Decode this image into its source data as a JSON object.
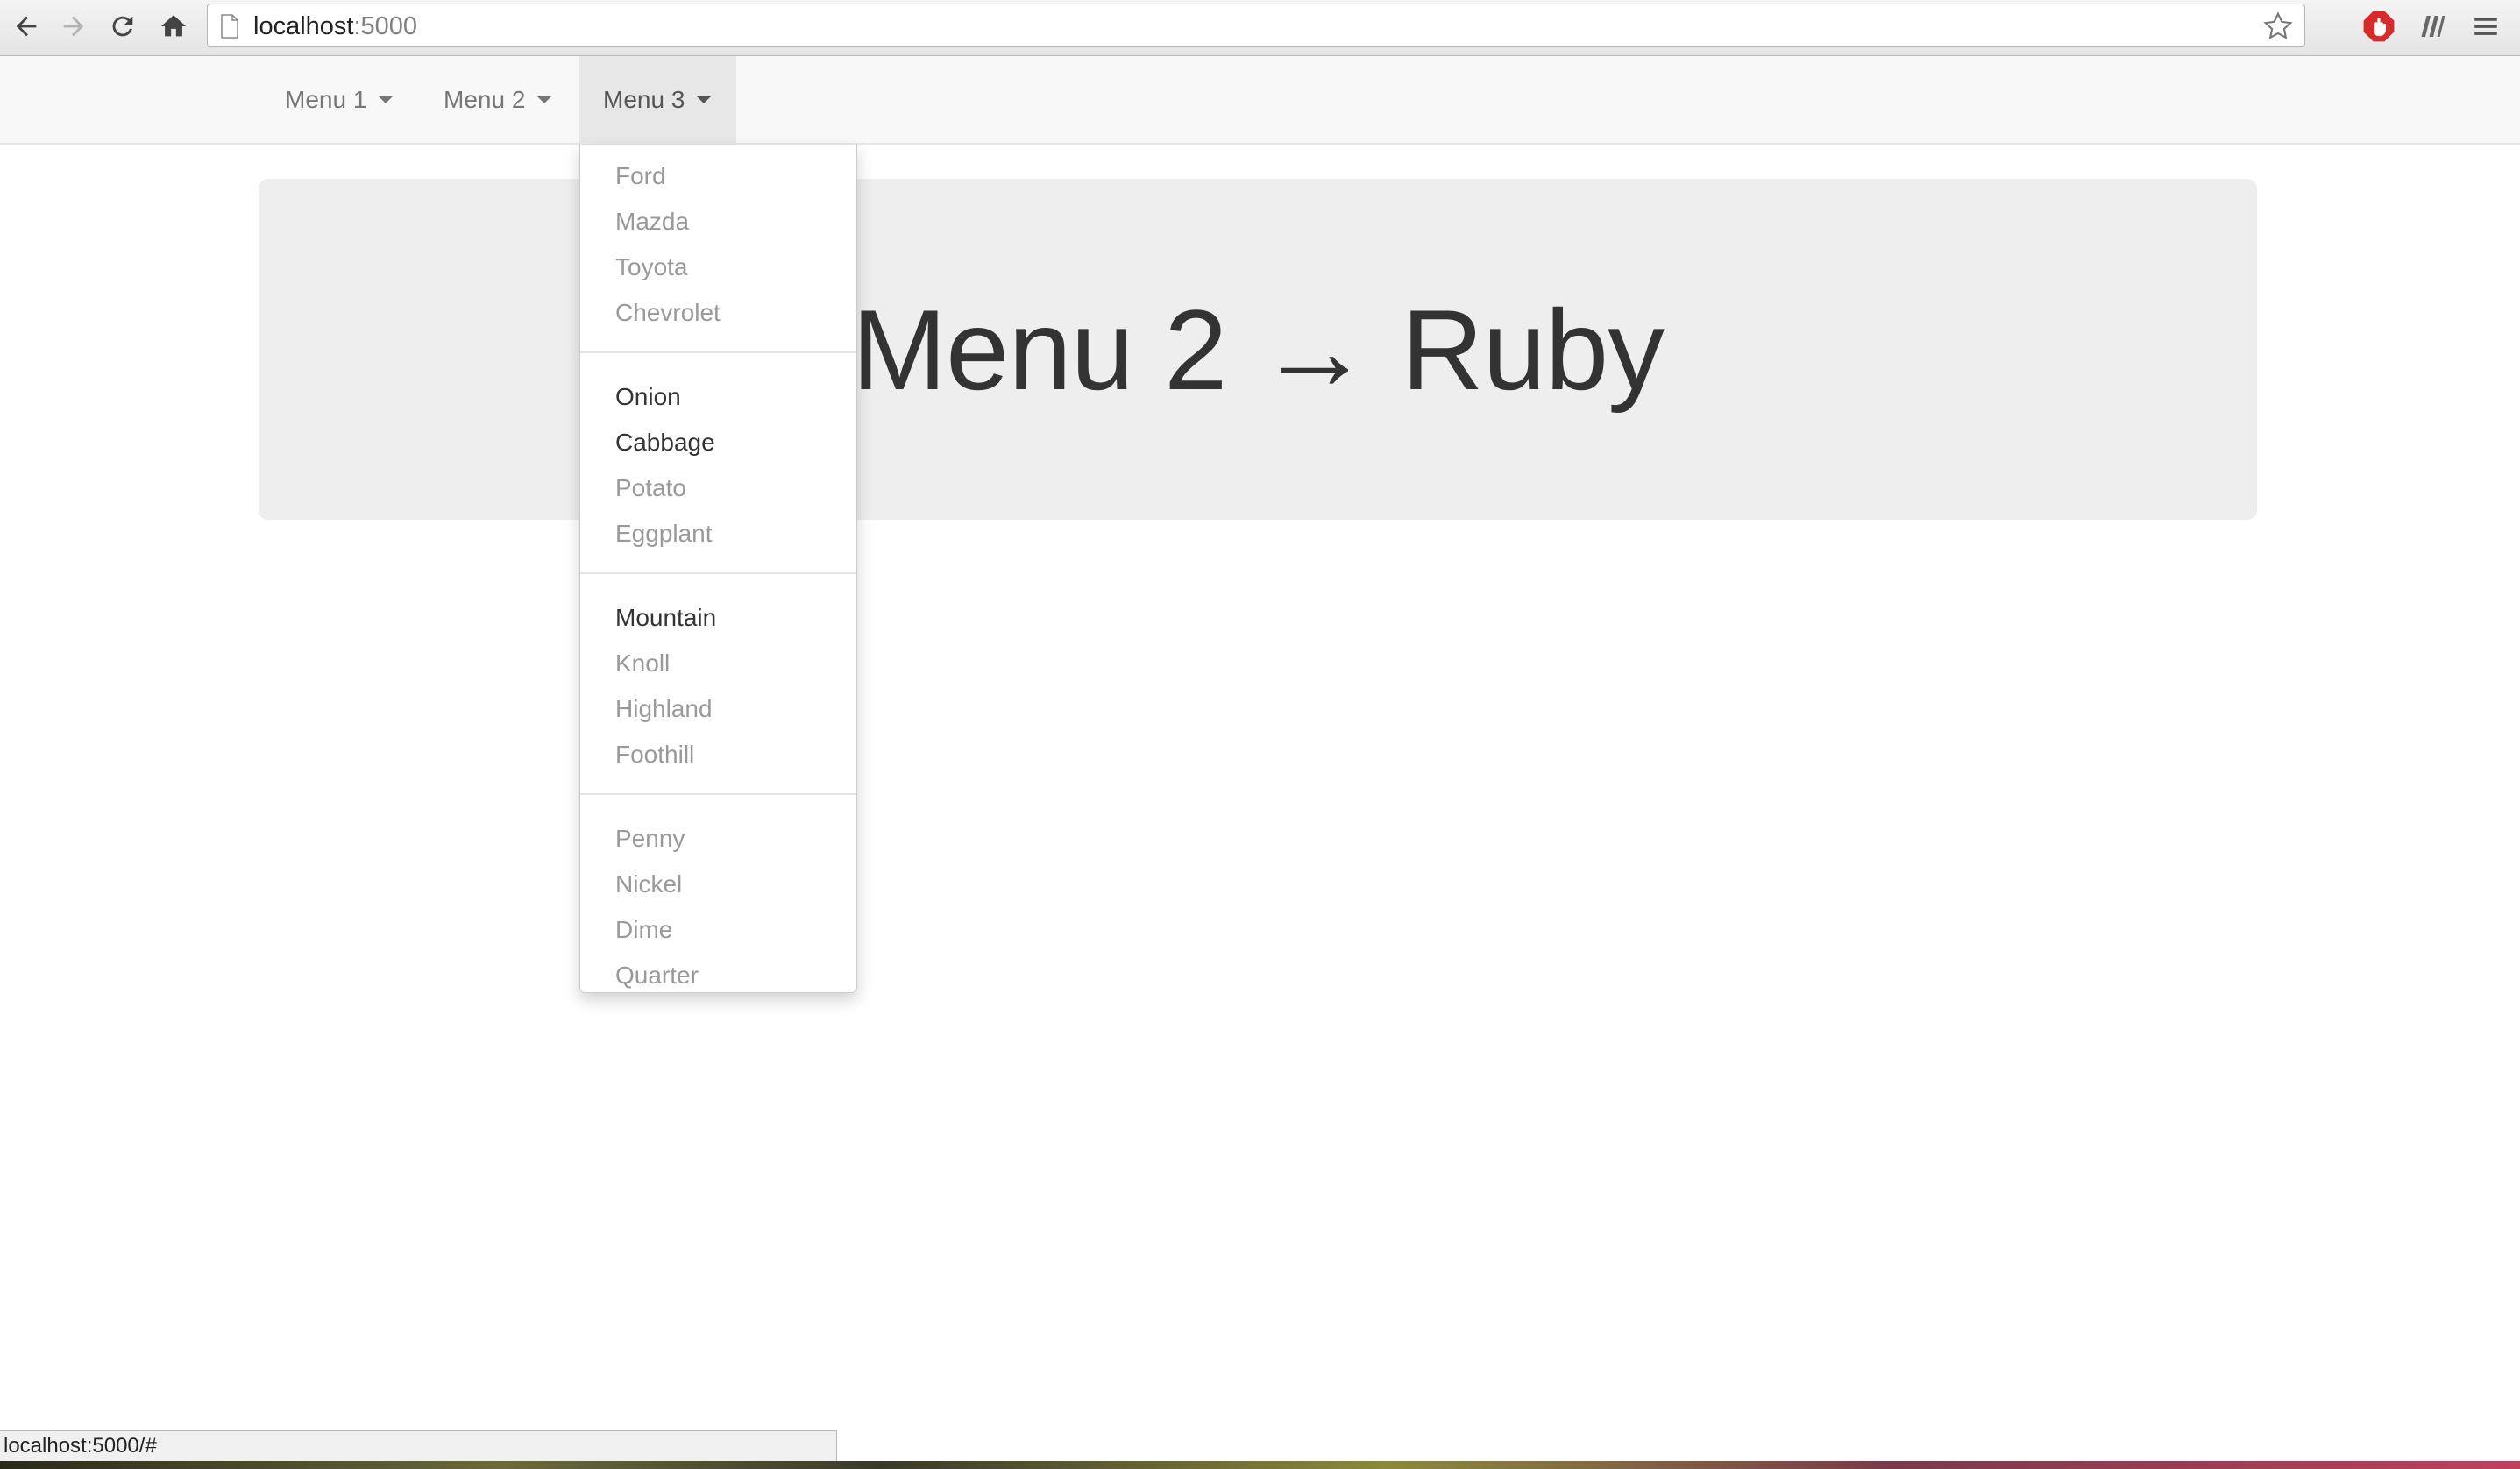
{
  "browser": {
    "url_host": "localhost",
    "url_rest": ":5000",
    "status_text": "localhost:5000/#"
  },
  "navbar": {
    "menus": [
      {
        "label": "Menu 1"
      },
      {
        "label": "Menu 2"
      },
      {
        "label": "Menu 3",
        "open": true
      }
    ]
  },
  "jumbotron": {
    "heading": "Menu 2 → Ruby"
  },
  "dropdown": {
    "groups": [
      {
        "items": [
          {
            "label": "Ford",
            "enabled": false
          },
          {
            "label": "Mazda",
            "enabled": false
          },
          {
            "label": "Toyota",
            "enabled": false
          },
          {
            "label": "Chevrolet",
            "enabled": false
          }
        ]
      },
      {
        "items": [
          {
            "label": "Onion",
            "enabled": true
          },
          {
            "label": "Cabbage",
            "enabled": true
          },
          {
            "label": "Potato",
            "enabled": false
          },
          {
            "label": "Eggplant",
            "enabled": false
          }
        ]
      },
      {
        "items": [
          {
            "label": "Mountain",
            "enabled": true
          },
          {
            "label": "Knoll",
            "enabled": false
          },
          {
            "label": "Highland",
            "enabled": false
          },
          {
            "label": "Foothill",
            "enabled": false
          }
        ]
      },
      {
        "items": [
          {
            "label": "Penny",
            "enabled": false
          },
          {
            "label": "Nickel",
            "enabled": false
          },
          {
            "label": "Dime",
            "enabled": false
          },
          {
            "label": "Quarter",
            "enabled": false
          }
        ]
      }
    ]
  },
  "colors": {
    "navbar_bg": "#f8f8f8",
    "active_menu_bg": "#e7e7e7",
    "jumbotron_bg": "#eeeeee",
    "disabled_item": "#999999",
    "enabled_item": "#333333"
  },
  "icons": [
    "back-arrow-icon",
    "forward-arrow-icon",
    "reload-icon",
    "home-icon",
    "page-icon",
    "star-icon",
    "adblock-icon",
    "readability-icon",
    "menu-icon"
  ]
}
